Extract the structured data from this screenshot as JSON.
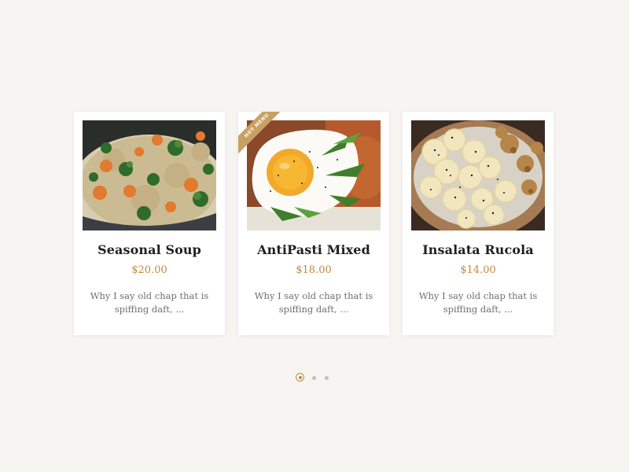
{
  "menu": {
    "cards": [
      {
        "title": "Seasonal Soup",
        "price": "$20.00",
        "description": "Why I say old chap that is spiffing daft, ...",
        "image_icon": "quinoa-vegetables-image"
      },
      {
        "title": "AntiPasti Mixed",
        "price": "$18.00",
        "description": "Why I say old chap that is spiffing daft, ...",
        "badge": "HOT MENU",
        "image_icon": "fried-egg-salad-image"
      },
      {
        "title": "Insalata Rucola",
        "price": "$14.00",
        "description": "Why I say old chap that is spiffing daft, ...",
        "image_icon": "banana-walnut-bowl-image"
      }
    ]
  },
  "carousel": {
    "page_count": 3,
    "active_index": 0
  },
  "colors": {
    "background": "#f6f5f2",
    "accent": "#c08a3e",
    "badge": "#c9a063",
    "title": "#1f1f1f",
    "text": "#6f6f6f"
  }
}
